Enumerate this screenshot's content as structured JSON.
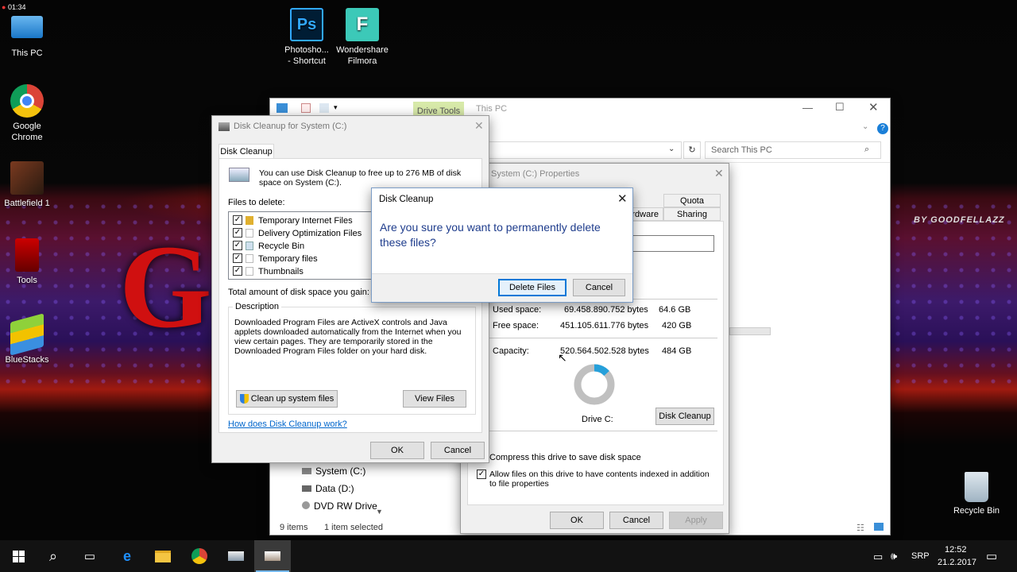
{
  "desktop": {
    "clock_overlay": "01:34",
    "wallpaper_text": "G",
    "wallpaper_credit": "BY GOODFELLAZZ",
    "icons": [
      {
        "label": "This PC"
      },
      {
        "label": "Google Chrome"
      },
      {
        "label": "Battlefield 1"
      },
      {
        "label": "Tools"
      },
      {
        "label": "BlueStacks"
      },
      {
        "label": "Photosho... - Shortcut"
      },
      {
        "label": "Wondershare Filmora"
      },
      {
        "label": "Recycle Bin"
      }
    ]
  },
  "explorer": {
    "ribbon_tab": "Drive Tools",
    "title": "This PC",
    "search_placeholder": "Search This PC",
    "nav": [
      "System (C:)",
      "Data (D:)",
      "DVD RW Drive"
    ],
    "status_items": "9 items",
    "status_selected": "1 item selected"
  },
  "properties": {
    "title": "System (C:) Properties",
    "tabs": [
      "Quota",
      "Hardware",
      "Sharing"
    ],
    "used_label": "Used space:",
    "used_bytes": "69.458.890.752 bytes",
    "used_gb": "64.6 GB",
    "free_label": "Free space:",
    "free_bytes": "451.105.611.776 bytes",
    "free_gb": "420 GB",
    "capacity_label": "Capacity:",
    "capacity_bytes": "520.564.502.528 bytes",
    "capacity_gb": "484 GB",
    "drive_label": "Drive C:",
    "disk_cleanup": "Disk Cleanup",
    "compress": "Compress this drive to save disk space",
    "index": "Allow files on this drive to have contents indexed in addition to file properties",
    "ok": "OK",
    "cancel": "Cancel",
    "apply": "Apply",
    "used_fraction": 0.133
  },
  "cleanup": {
    "title": "Disk Cleanup for System (C:)",
    "tab": "Disk Cleanup",
    "intro": "You can use Disk Cleanup to free up to 276 MB of disk space on System (C:).",
    "files_to_delete": "Files to delete:",
    "files": [
      {
        "name": "Temporary Internet Files",
        "checked": true
      },
      {
        "name": "Delivery Optimization Files",
        "checked": true
      },
      {
        "name": "Recycle Bin",
        "checked": true
      },
      {
        "name": "Temporary files",
        "checked": true
      },
      {
        "name": "Thumbnails",
        "checked": true
      }
    ],
    "total_label": "Total amount of disk space you gain:",
    "description_label": "Description",
    "description": "Downloaded Program Files are ActiveX controls and Java applets downloaded automatically from the Internet when you view certain pages. They are temporarily stored in the Downloaded Program Files folder on your hard disk.",
    "clean_system": "Clean up system files",
    "view_files": "View Files",
    "how_link": "How does Disk Cleanup work?",
    "ok": "OK",
    "cancel": "Cancel"
  },
  "confirm": {
    "title": "Disk Cleanup",
    "message": "Are you sure you want to permanently delete these files?",
    "delete": "Delete Files",
    "cancel": "Cancel"
  },
  "taskbar": {
    "lang": "SRP",
    "time": "12:52",
    "date": "21.2.2017"
  }
}
